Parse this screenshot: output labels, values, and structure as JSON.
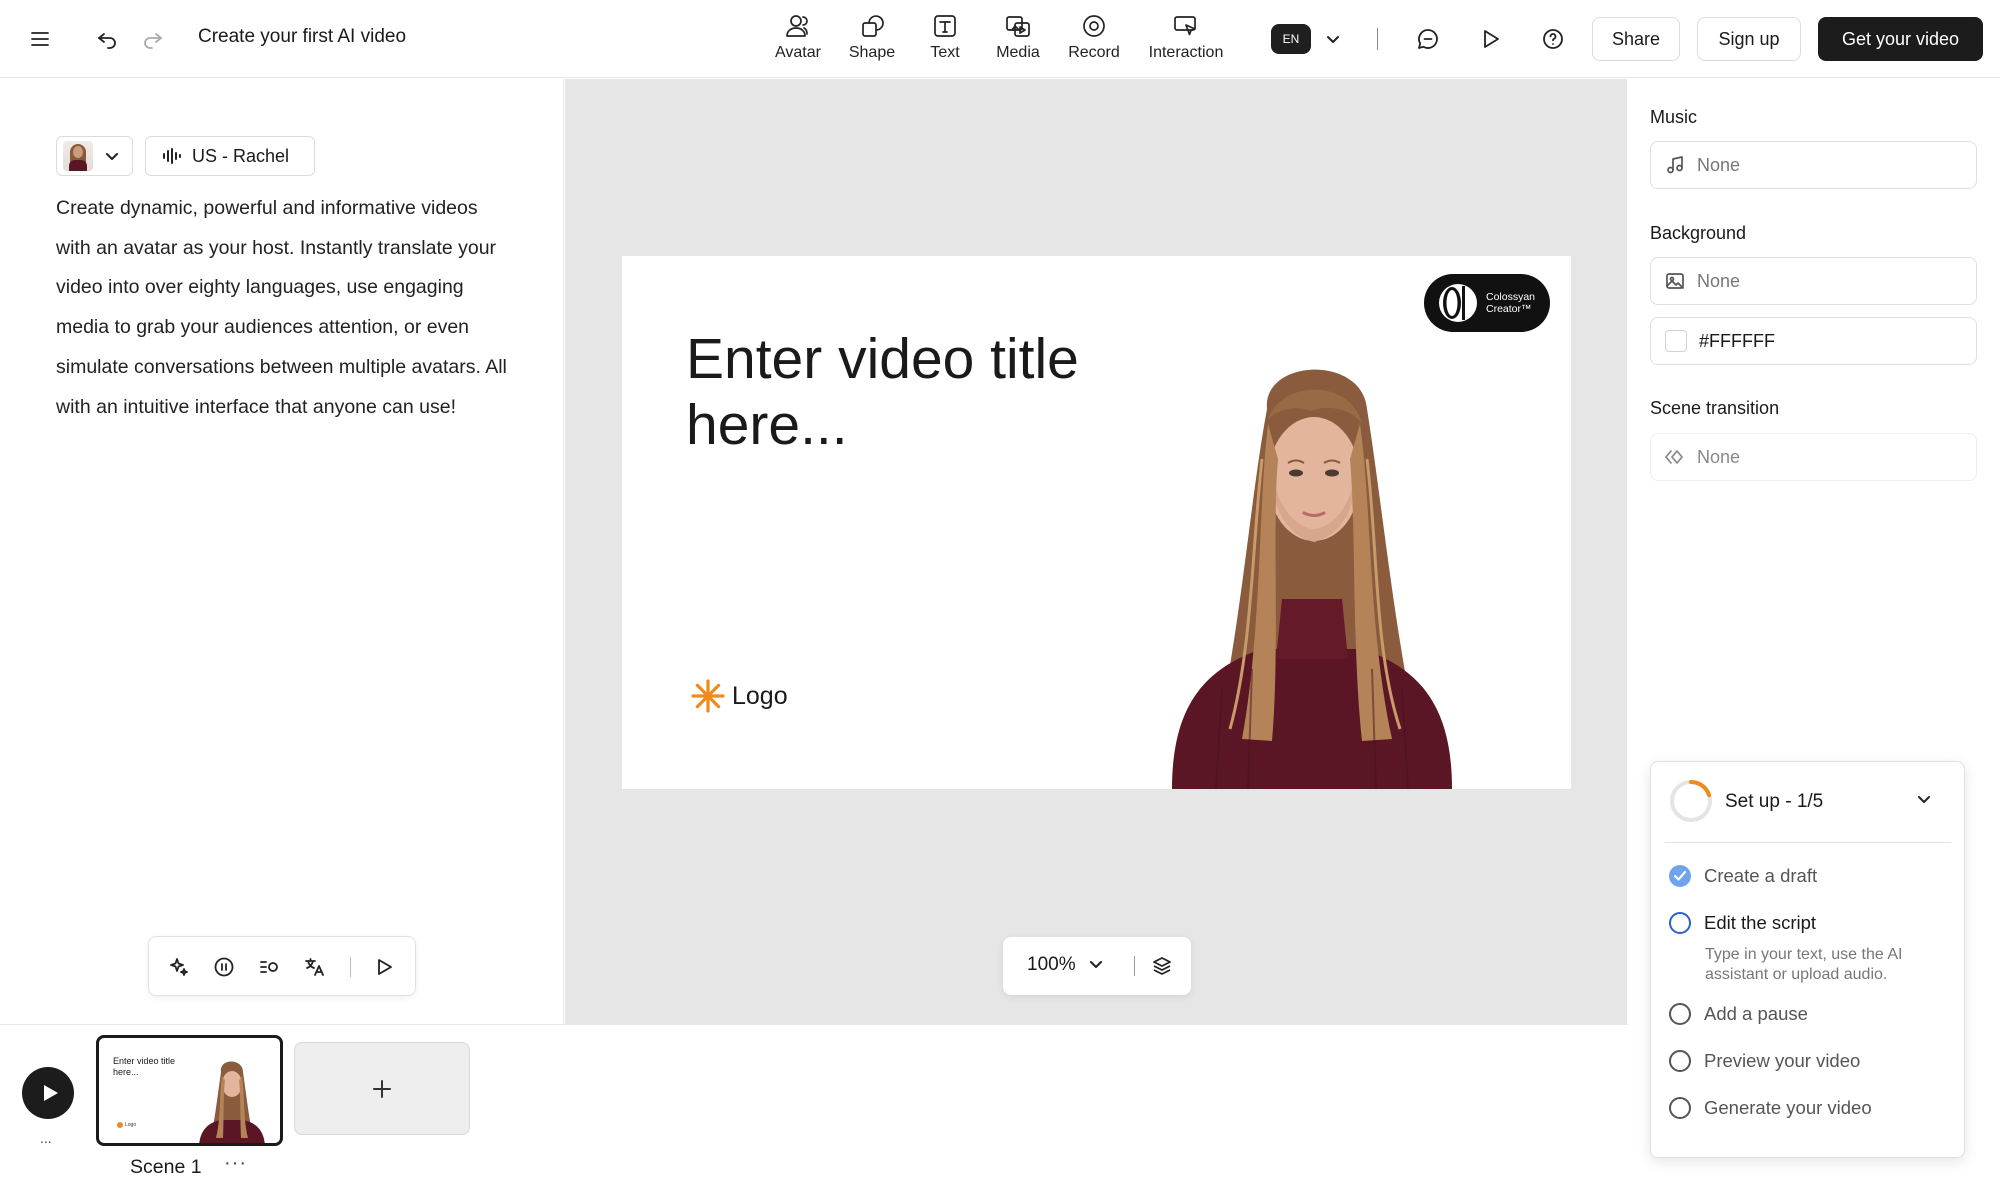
{
  "header": {
    "document_title": "Create your first AI video",
    "tools": [
      {
        "label": "Avatar",
        "icon": "avatar-icon"
      },
      {
        "label": "Shape",
        "icon": "shape-icon"
      },
      {
        "label": "Text",
        "icon": "text-icon"
      },
      {
        "label": "Media",
        "icon": "media-icon"
      },
      {
        "label": "Record",
        "icon": "record-icon"
      },
      {
        "label": "Interaction",
        "icon": "interaction-icon"
      }
    ],
    "language": "EN",
    "share_label": "Share",
    "signup_label": "Sign up",
    "get_video_label": "Get your video"
  },
  "script": {
    "voice_label": "US - Rachel",
    "text": "Create dynamic, powerful and informative videos with an avatar as your host. Instantly translate your video into over eighty languages, use engaging media to grab your audiences attention, or even simulate conversations between multiple avatars. All with an intuitive interface that anyone can use!",
    "toolbar_icons": [
      "ai-sparkle-icon",
      "pause-icon",
      "list-icon",
      "translate-icon",
      "play-icon"
    ]
  },
  "canvas": {
    "slide_title": "Enter video title here...",
    "logo_text": "Logo",
    "badge_text_line1": "Colossyan",
    "badge_text_line2": "Creator™",
    "zoom": "100%"
  },
  "properties": {
    "music_label": "Music",
    "music_value": "None",
    "background_label": "Background",
    "background_media_value": "None",
    "background_color_value": "#FFFFFF",
    "transition_label": "Scene transition",
    "transition_value": "None"
  },
  "setup": {
    "title": "Set up - 1/5",
    "progress": 0.2,
    "steps": [
      {
        "label": "Create a draft",
        "state": "done"
      },
      {
        "label": "Edit the script",
        "state": "active",
        "description": "Type in your text, use the AI assistant or upload audio."
      },
      {
        "label": "Add a pause",
        "state": "todo"
      },
      {
        "label": "Preview your video",
        "state": "todo"
      },
      {
        "label": "Generate your video",
        "state": "todo"
      }
    ]
  },
  "timeline": {
    "scene_name": "Scene 1",
    "thumb_title": "Enter video title here...",
    "thumb_logo": "Logo",
    "more_label": "...",
    "scene_more_label": "···"
  },
  "colors": {
    "accent_orange": "#F08A1A",
    "primary_dark": "#1C1C1C",
    "check_blue": "#6FA3EE",
    "active_blue": "#2A62CF",
    "canvas_bg": "#E6E6E6",
    "avatar_sweater": "#5A1624"
  }
}
